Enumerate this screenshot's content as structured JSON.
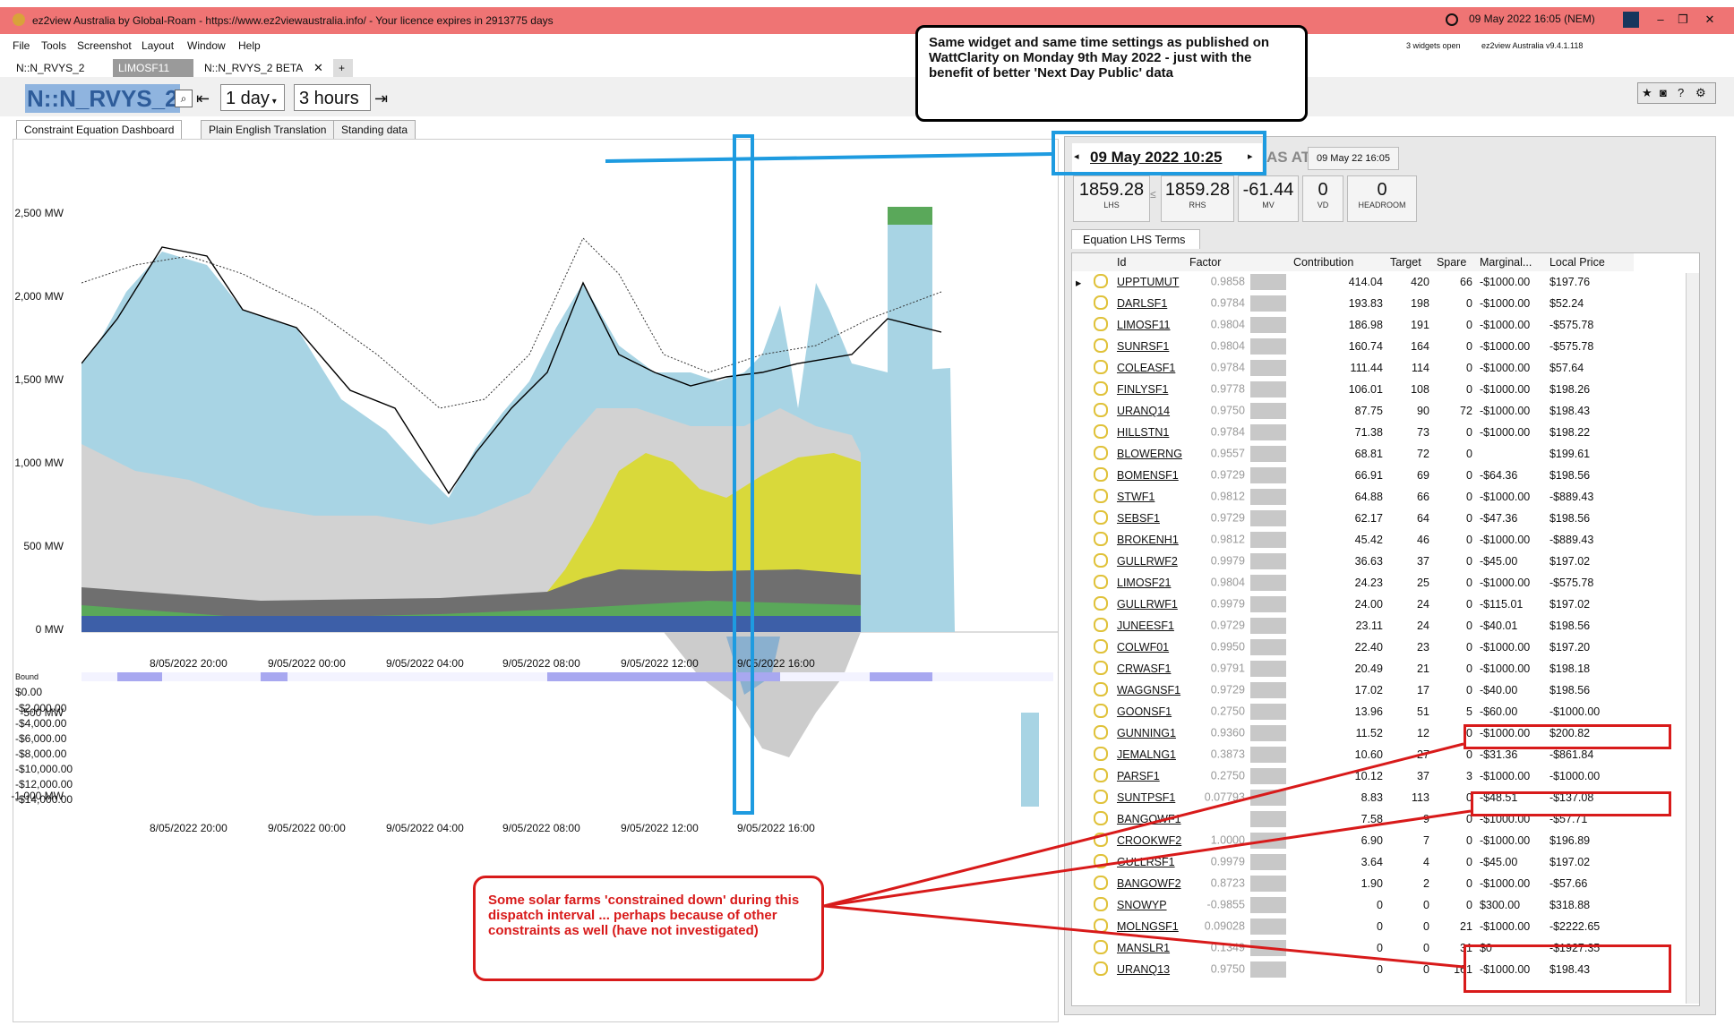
{
  "window": {
    "title": "ez2view Australia by Global-Roam - https://www.ez2viewaustralia.info/ - Your licence expires in 2913775 days",
    "clock": "09 May 2022 16:05 (NEM)"
  },
  "menu": [
    "File",
    "Tools",
    "Screenshot",
    "Layout",
    "Window",
    "Help"
  ],
  "status": {
    "widgets": "3 widgets open",
    "version": "ez2view Australia v9.4.1.118"
  },
  "tabs": [
    "N::N_RVYS_2",
    "LIMOSF11",
    "N::N_RVYS_2 BETA",
    "+"
  ],
  "toolbar": {
    "constraint": "N::N_RVYS_2",
    "range": "1 day",
    "step": "3 hours"
  },
  "subtabs": [
    "Constraint Equation Dashboard",
    "Plain English Translation",
    "Standing data"
  ],
  "chart": {
    "y_ticks": [
      "2,500 MW",
      "2,000 MW",
      "1,500 MW",
      "1,000 MW",
      "500 MW",
      "0 MW",
      "-500 MW",
      "-1,000 MW"
    ],
    "x_ticks": [
      "8/05/2022 20:00",
      "9/05/2022 00:00",
      "9/05/2022 04:00",
      "9/05/2022 08:00",
      "9/05/2022 12:00",
      "9/05/2022 16:00"
    ],
    "bound_label": "Bound",
    "price_ticks": [
      "$0.00",
      "-$2,000.00",
      "-$4,000.00",
      "-$6,000.00",
      "-$8,000.00",
      "-$10,000.00",
      "-$12,000.00",
      "-$14,000.00"
    ]
  },
  "chart_data": {
    "type": "area",
    "title": "",
    "ylim": [
      -1000,
      2750
    ],
    "x": [
      "8/05/2022 20:00",
      "9/05/2022 00:00",
      "9/05/2022 04:00",
      "9/05/2022 08:00",
      "9/05/2022 12:00",
      "9/05/2022 16:00"
    ],
    "series": [
      {
        "name": "",
        "values": [
          1900,
          1700,
          1000,
          1950,
          1600,
          1800
        ]
      },
      {
        "name": "",
        "values": [
          1950,
          1750,
          1050,
          2000,
          1700,
          1900
        ]
      }
    ]
  },
  "interval": {
    "time": "09 May 2022 10:25",
    "as_at_label": "AS AT",
    "as_at": "09 May 22 16:05"
  },
  "values": [
    {
      "v": "1859.28",
      "l": "LHS"
    },
    {
      "v": "≤",
      "l": ""
    },
    {
      "v": "1859.28",
      "l": "RHS"
    },
    {
      "v": "-61.44",
      "l": "MV"
    },
    {
      "v": "0",
      "l": "VD"
    },
    {
      "v": "0",
      "l": "HEADROOM"
    }
  ],
  "lhs_tab": "Equation LHS Terms",
  "columns": [
    "Id",
    "Factor",
    "Contribution",
    "Target",
    "Spare",
    "Marginal...",
    "Local Price"
  ],
  "rows": [
    [
      "UPPTUMUT",
      "0.9858",
      "414.04",
      "420",
      "66",
      "-$1000.00",
      "$197.76"
    ],
    [
      "DARLSF1",
      "0.9784",
      "193.83",
      "198",
      "0",
      "-$1000.00",
      "$52.24"
    ],
    [
      "LIMOSF11",
      "0.9804",
      "186.98",
      "191",
      "0",
      "-$1000.00",
      "-$575.78"
    ],
    [
      "SUNRSF1",
      "0.9804",
      "160.74",
      "164",
      "0",
      "-$1000.00",
      "-$575.78"
    ],
    [
      "COLEASF1",
      "0.9784",
      "111.44",
      "114",
      "0",
      "-$1000.00",
      "$57.64"
    ],
    [
      "FINLYSF1",
      "0.9778",
      "106.01",
      "108",
      "0",
      "-$1000.00",
      "$198.26"
    ],
    [
      "URANQ14",
      "0.9750",
      "87.75",
      "90",
      "72",
      "-$1000.00",
      "$198.43"
    ],
    [
      "HILLSTN1",
      "0.9784",
      "71.38",
      "73",
      "0",
      "-$1000.00",
      "$198.22"
    ],
    [
      "BLOWERNG",
      "0.9557",
      "68.81",
      "72",
      "0",
      "",
      "$199.61"
    ],
    [
      "BOMENSF1",
      "0.9729",
      "66.91",
      "69",
      "0",
      "-$64.36",
      "$198.56"
    ],
    [
      "STWF1",
      "0.9812",
      "64.88",
      "66",
      "0",
      "-$1000.00",
      "-$889.43"
    ],
    [
      "SEBSF1",
      "0.9729",
      "62.17",
      "64",
      "0",
      "-$47.36",
      "$198.56"
    ],
    [
      "BROKENH1",
      "0.9812",
      "45.42",
      "46",
      "0",
      "-$1000.00",
      "-$889.43"
    ],
    [
      "GULLRWF2",
      "0.9979",
      "36.63",
      "37",
      "0",
      "-$45.00",
      "$197.02"
    ],
    [
      "LIMOSF21",
      "0.9804",
      "24.23",
      "25",
      "0",
      "-$1000.00",
      "-$575.78"
    ],
    [
      "GULLRWF1",
      "0.9979",
      "24.00",
      "24",
      "0",
      "-$115.01",
      "$197.02"
    ],
    [
      "JUNEESF1",
      "0.9729",
      "23.11",
      "24",
      "0",
      "-$40.01",
      "$198.56"
    ],
    [
      "COLWF01",
      "0.9950",
      "22.40",
      "23",
      "0",
      "-$1000.00",
      "$197.20"
    ],
    [
      "CRWASF1",
      "0.9791",
      "20.49",
      "21",
      "0",
      "-$1000.00",
      "$198.18"
    ],
    [
      "WAGGNSF1",
      "0.9729",
      "17.02",
      "17",
      "0",
      "-$40.00",
      "$198.56"
    ],
    [
      "GOONSF1",
      "0.2750",
      "13.96",
      "51",
      "5",
      "-$60.00",
      "-$1000.00"
    ],
    [
      "GUNNING1",
      "0.9360",
      "11.52",
      "12",
      "0",
      "-$1000.00",
      "$200.82"
    ],
    [
      "JEMALNG1",
      "0.3873",
      "10.60",
      "27",
      "0",
      "-$31.36",
      "-$861.84"
    ],
    [
      "PARSF1",
      "0.2750",
      "10.12",
      "37",
      "3",
      "-$1000.00",
      "-$1000.00"
    ],
    [
      "SUNTPSF1",
      "0.07793",
      "8.83",
      "113",
      "0",
      "-$48.51",
      "-$137.08"
    ],
    [
      "BANGOWF1",
      "",
      "7.58",
      "9",
      "0",
      "-$1000.00",
      "-$57.71"
    ],
    [
      "CROOKWF2",
      "1.0000",
      "6.90",
      "7",
      "0",
      "-$1000.00",
      "$196.89"
    ],
    [
      "GULLRSF1",
      "0.9979",
      "3.64",
      "4",
      "0",
      "-$45.00",
      "$197.02"
    ],
    [
      "BANGOWF2",
      "0.8723",
      "1.90",
      "2",
      "0",
      "-$1000.00",
      "-$57.66"
    ],
    [
      "SNOWYP",
      "-0.9855",
      "0",
      "0",
      "0",
      "$300.00",
      "$318.88"
    ],
    [
      "MOLNGSF1",
      "0.09028",
      "0",
      "0",
      "21",
      "-$1000.00",
      "-$2222.65"
    ],
    [
      "MANSLR1",
      "0.1349",
      "0",
      "0",
      "31",
      "$0",
      "-$1927.35"
    ],
    [
      "URANQ13",
      "0.9750",
      "0",
      "0",
      "161",
      "-$1000.00",
      "$198.43"
    ]
  ],
  "annotations": {
    "top": "Same widget and same time settings as published on WattClarity on Monday 9th May 2022 - just with the benefit of better 'Next Day Public' data",
    "bottom": "Some solar farms 'constrained down' during this dispatch interval ... perhaps because of other constraints as well (have not investigated)"
  },
  "colors": {
    "title_bar": "#ef7474",
    "highlight": "#1e9be0",
    "annotation_red": "#d81a1a"
  }
}
